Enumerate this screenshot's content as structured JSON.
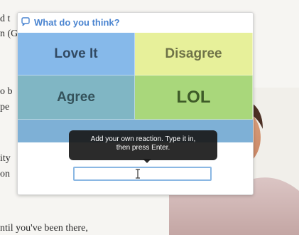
{
  "article": {
    "line_1": "d t",
    "line_2": "n (G",
    "line_3": "o b",
    "line_4": "pe",
    "line_5": "ity",
    "line_6": "on",
    "bottom_line": "ntil you've been there,"
  },
  "popup": {
    "title": "What do you think?",
    "icon": "chat-bubble-icon",
    "reactions": {
      "love_it": "Love It",
      "disagree": "Disagree",
      "agree": "Agree",
      "lol": "LOL"
    },
    "tooltip": {
      "line_1": "Add your own reaction. Type it in,",
      "line_2": "then press Enter."
    },
    "input": {
      "value": "",
      "placeholder": ""
    }
  },
  "colors": {
    "love_it": "#86b9ea",
    "disagree": "#e7f09a",
    "agree": "#80b6c4",
    "lol": "#a9d77b",
    "accent": "#4a84d0",
    "tooltip_bg": "#191919"
  }
}
